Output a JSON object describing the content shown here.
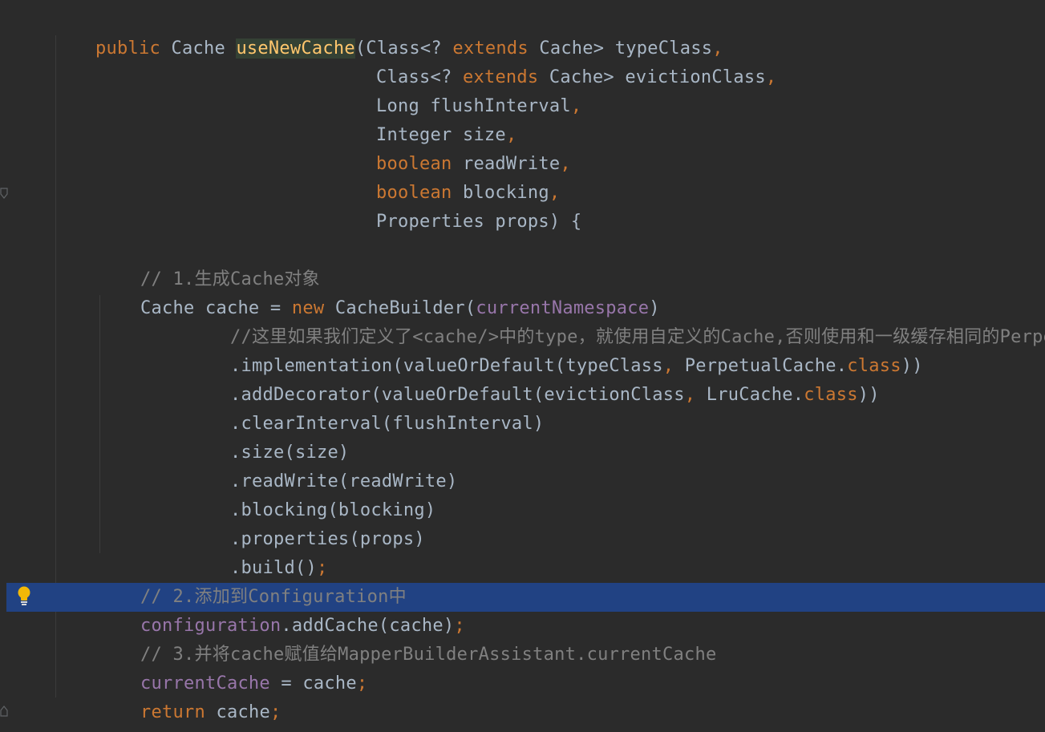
{
  "editor": {
    "theme_colors": {
      "background": "#2b2b2b",
      "keyword": "#cc7832",
      "identifier": "#a9b7c6",
      "field": "#9876aa",
      "comment": "#808080",
      "method_highlight": "#ffc66d",
      "current_line": "#214283"
    },
    "gutter": {
      "intention_icon": "lightbulb-icon"
    },
    "code": {
      "l1": {
        "t1": "public",
        "t2": " Cache ",
        "t3": "useNewCache",
        "t4": "(Class<? ",
        "t5": "extends",
        "t6": " Cache> typeClass",
        "t7": ","
      },
      "l2": {
        "t1": "Class<? ",
        "t2": "extends",
        "t3": " Cache> evictionClass",
        "t4": ","
      },
      "l3": {
        "t1": "Long flushInterval",
        "t2": ","
      },
      "l4": {
        "t1": "Integer size",
        "t2": ","
      },
      "l5": {
        "t1": "boolean",
        "t2": " readWrite",
        "t3": ","
      },
      "l6": {
        "t1": "boolean",
        "t2": " blocking",
        "t3": ","
      },
      "l7": {
        "t1": "Properties props) {"
      },
      "l9": {
        "t1": "// 1.生成Cache对象"
      },
      "l10": {
        "t1": "Cache cache = ",
        "t2": "new",
        "t3": " CacheBuilder(",
        "t4": "currentNamespace",
        "t5": ")"
      },
      "l11": {
        "t1": "//这里如果我们定义了<cache/>中的type，就使用自定义的Cache,否则使用和一级缓存相同的PerpetualCache"
      },
      "l12": {
        "t1": ".implementation(valueOrDefault(typeClass",
        "t2": ",",
        "t3": " PerpetualCache.",
        "t4": "class",
        "t5": "))"
      },
      "l13": {
        "t1": ".addDecorator(valueOrDefault(evictionClass",
        "t2": ",",
        "t3": " LruCache.",
        "t4": "class",
        "t5": "))"
      },
      "l14": {
        "t1": ".clearInterval(flushInterval)"
      },
      "l15": {
        "t1": ".size(size)"
      },
      "l16": {
        "t1": ".readWrite(readWrite)"
      },
      "l17": {
        "t1": ".blocking(blocking)"
      },
      "l18": {
        "t1": ".properties(props)"
      },
      "l19": {
        "t1": ".build()",
        "t2": ";"
      },
      "l20": {
        "t1": "// 2.添加到Configuration中"
      },
      "l21": {
        "t1": "configuration",
        "t2": ".addCache(cache)",
        "t3": ";"
      },
      "l22": {
        "t1": "// 3.并将cache赋值给MapperBuilderAssistant.currentCache"
      },
      "l23": {
        "t1": "currentCache",
        "t2": " = cache",
        "t3": ";"
      },
      "l24": {
        "t1": "return",
        "t2": " cache",
        "t3": ";"
      },
      "l25": {
        "t1": "}"
      }
    }
  }
}
